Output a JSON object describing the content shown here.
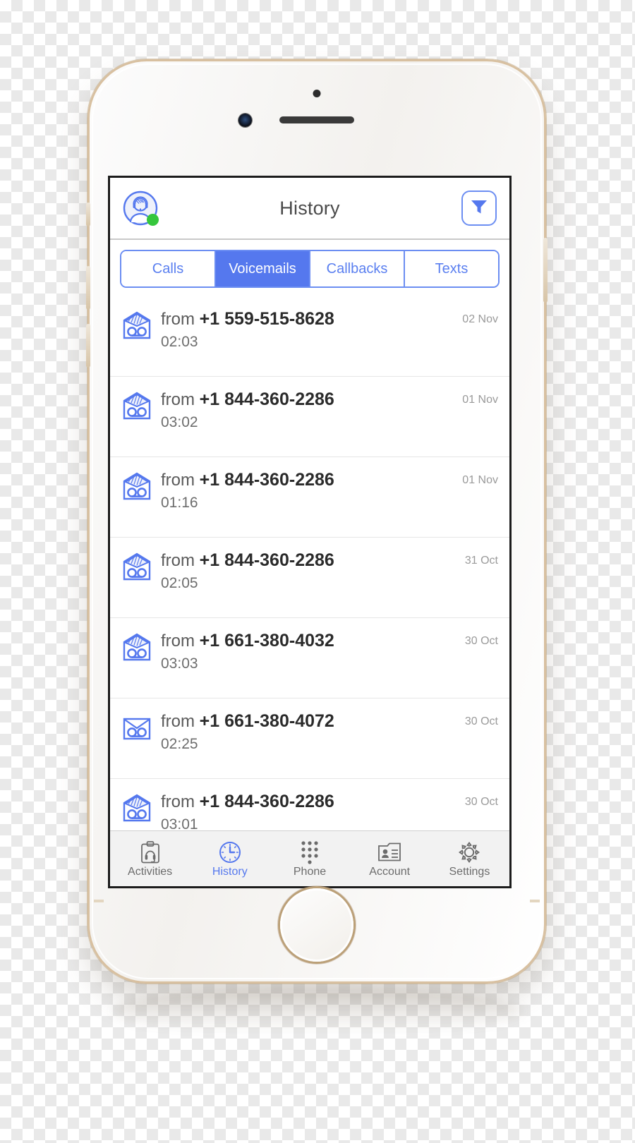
{
  "app": {
    "header": {
      "title": "History",
      "avatar_icon": "agent-avatar-headset-icon",
      "status": "online",
      "status_color": "#35c63c",
      "filter_icon": "filter-funnel-icon"
    },
    "accent_color": "#5578ee",
    "segmented_tabs": [
      {
        "label": "Calls",
        "active": false
      },
      {
        "label": "Voicemails",
        "active": true
      },
      {
        "label": "Callbacks",
        "active": false
      },
      {
        "label": "Texts",
        "active": false
      }
    ],
    "voicemails": [
      {
        "prefix": "from",
        "number": "+1 559-515-8628",
        "duration": "02:03",
        "date": "02 Nov",
        "icon": "voicemail-envelope-open-icon"
      },
      {
        "prefix": "from",
        "number": "+1 844-360-2286",
        "duration": "03:02",
        "date": "01 Nov",
        "icon": "voicemail-envelope-open-icon"
      },
      {
        "prefix": "from",
        "number": "+1 844-360-2286",
        "duration": "01:16",
        "date": "01 Nov",
        "icon": "voicemail-envelope-open-icon"
      },
      {
        "prefix": "from",
        "number": "+1 844-360-2286",
        "duration": "02:05",
        "date": "31 Oct",
        "icon": "voicemail-envelope-open-icon"
      },
      {
        "prefix": "from",
        "number": "+1 661-380-4032",
        "duration": "03:03",
        "date": "30 Oct",
        "icon": "voicemail-envelope-open-icon"
      },
      {
        "prefix": "from",
        "number": "+1 661-380-4072",
        "duration": "02:25",
        "date": "30 Oct",
        "icon": "voicemail-envelope-closed-icon"
      },
      {
        "prefix": "from",
        "number": "+1 844-360-2286",
        "duration": "03:01",
        "date": "30 Oct",
        "icon": "voicemail-envelope-open-icon"
      }
    ],
    "tabbar": [
      {
        "label": "Activities",
        "icon": "clipboard-headset-icon",
        "active": false
      },
      {
        "label": "History",
        "icon": "clock-icon",
        "active": true
      },
      {
        "label": "Phone",
        "icon": "dialpad-icon",
        "active": false
      },
      {
        "label": "Account",
        "icon": "contact-card-icon",
        "active": false
      },
      {
        "label": "Settings",
        "icon": "gear-icon",
        "active": false
      }
    ]
  }
}
